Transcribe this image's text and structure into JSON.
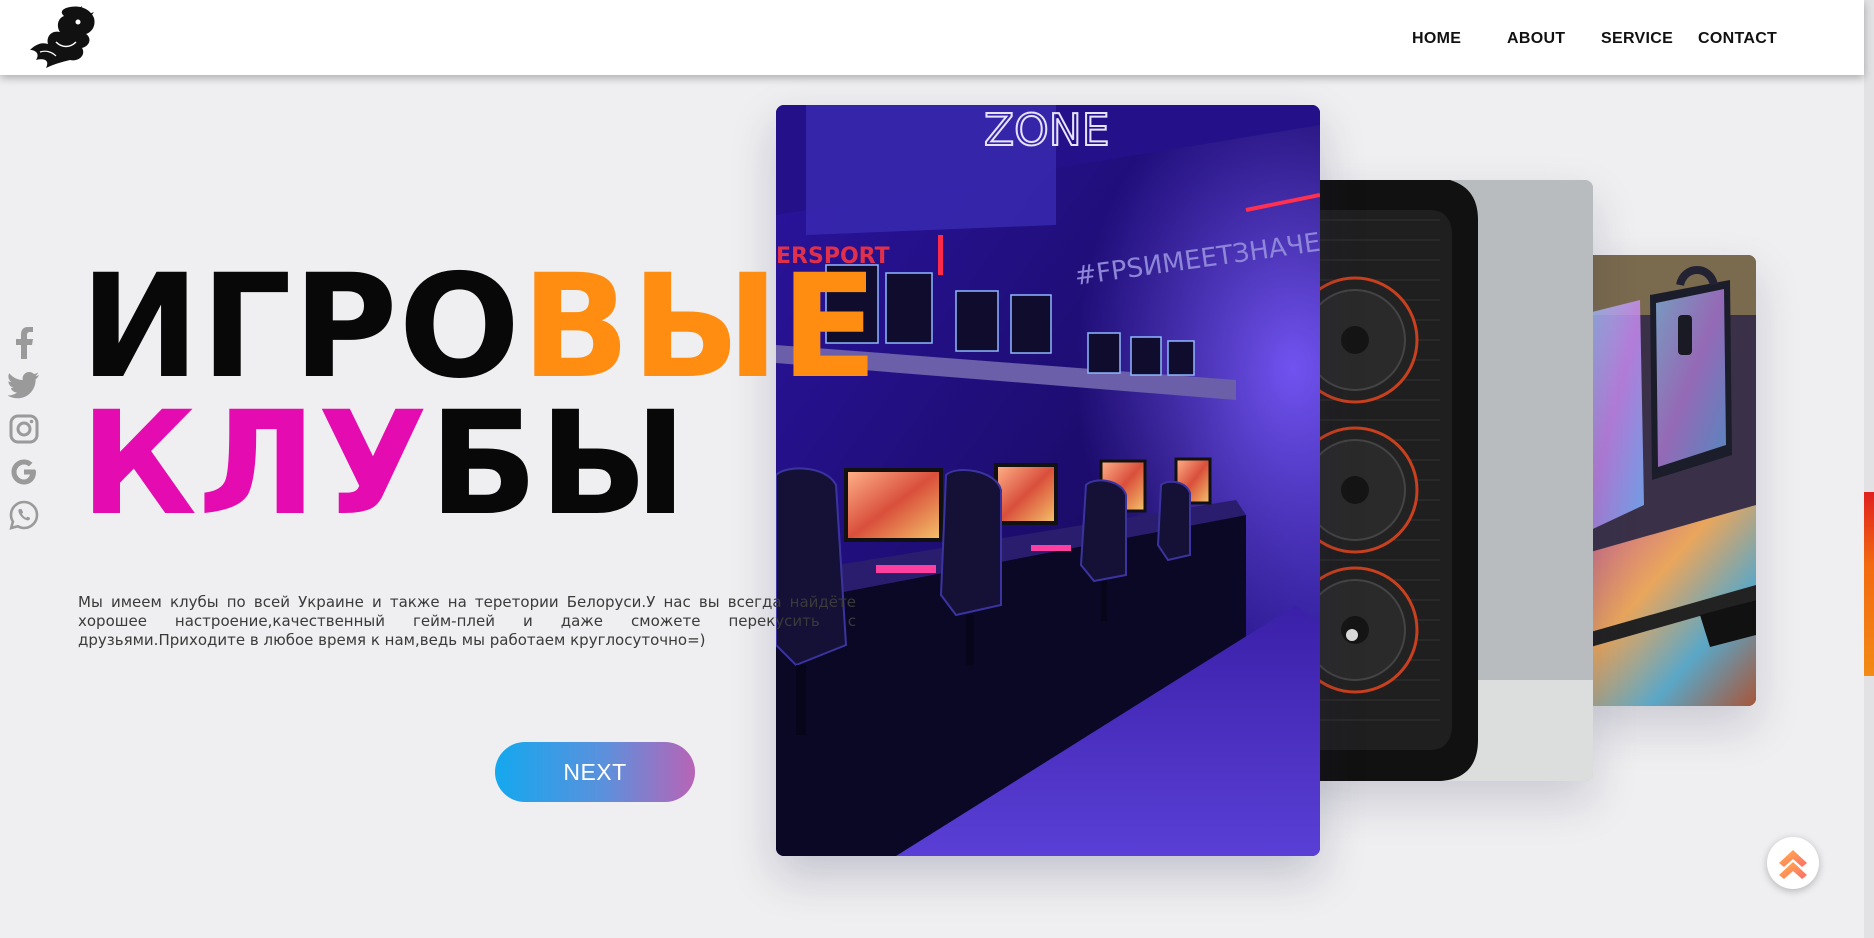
{
  "header": {
    "logo_icon": "dragon-logo-icon",
    "nav": [
      {
        "label": "HOME"
      },
      {
        "label": "ABOUT"
      },
      {
        "label": "SERVICE"
      },
      {
        "label": "CONTACT"
      }
    ]
  },
  "social": [
    "facebook-icon",
    "twitter-icon",
    "instagram-icon",
    "google-icon",
    "whatsapp-icon"
  ],
  "hero": {
    "title_line1": {
      "part1": "ИГРО",
      "part2": "ВЫЕ"
    },
    "title_line2": {
      "part1": "КЛУ",
      "part2": "БЫ"
    },
    "description": "Мы имеем клубы по всей Украине и также на теретории Белоруси.У нас вы всегда найдёте хорошее настроение,качественный гейм-плей и даже сможете перекусить с друзьями.Приходите в любое время к нам,ведь мы работаем круглосуточно=)",
    "next_label": "NEXT"
  },
  "slides": {
    "main_neon_text": "#FPSИМЕЕТЗНАЧЕНИЕ",
    "main_sign_text": "ZONE",
    "main_sport_text": "ERSPORT"
  },
  "colors": {
    "orange": "#ff8d12",
    "magenta": "#e40bb0",
    "button_start": "#14a8ee",
    "button_end": "#b864b6"
  },
  "scroll_top_icon": "double-chevron-up-icon"
}
